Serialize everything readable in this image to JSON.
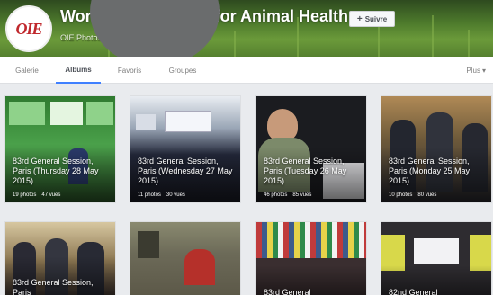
{
  "header": {
    "title": "World Organisation for Animal Health",
    "subtitle": "OIE Photos",
    "follow_label": "Suivre",
    "logo_text": "OIE"
  },
  "tabs": [
    {
      "label": "Galerie",
      "active": false
    },
    {
      "label": "Albums",
      "active": true
    },
    {
      "label": "Favoris",
      "active": false
    },
    {
      "label": "Groupes",
      "active": false
    }
  ],
  "more_label": "Plus",
  "albums": [
    {
      "title": "83rd General Session, Paris (Thursday 28 May 2015)",
      "photos": "19 photos",
      "views": "47 vues",
      "bg": "#3e8a3a"
    },
    {
      "title": "83rd General Session, Paris (Wednesday 27 May 2015)",
      "photos": "11 photos",
      "views": "30 vues",
      "bg": "#2f3d52"
    },
    {
      "title": "83rd General Session, Paris (Tuesday 26 May 2015)",
      "photos": "46 photos",
      "views": "85 vues",
      "bg": "#1b1c20"
    },
    {
      "title": "83rd General Session, Paris (Monday 25 May 2015)",
      "photos": "10 photos",
      "views": "80 vues",
      "bg": "#6e5a3a"
    },
    {
      "title": "83rd General Session, Paris",
      "photos": "",
      "views": "",
      "bg": "#7a6a4a"
    },
    {
      "title": "",
      "photos": "",
      "views": "",
      "bg": "#6c6a58"
    },
    {
      "title": "83rd General",
      "photos": "",
      "views": "",
      "bg": "#3d5b8c"
    },
    {
      "title": "82nd General",
      "photos": "",
      "views": "",
      "bg": "#2e2c30"
    }
  ],
  "colors": {
    "accent": "#4080ff",
    "logo_red": "#c0282d"
  },
  "icons": {
    "follow": "plus-icon",
    "more": "chevron-down-icon"
  }
}
